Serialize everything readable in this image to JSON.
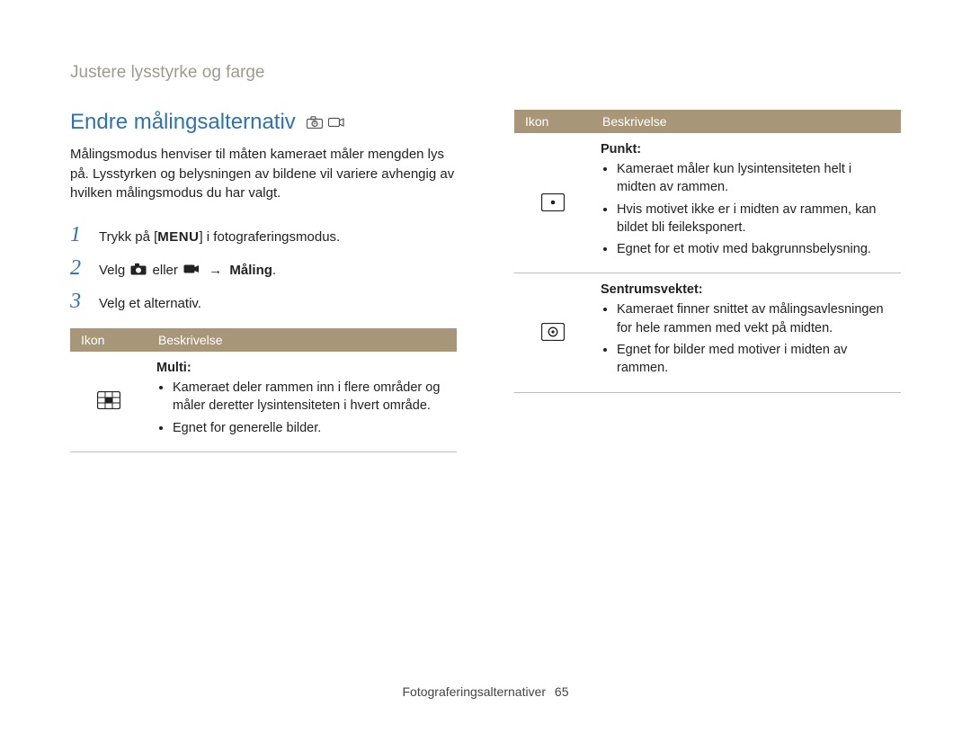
{
  "breadcrumb": "Justere lysstyrke og farge",
  "section_title": "Endre målingsalternativ",
  "intro": "Målingsmodus henviser til måten kameraet måler mengden lys på. Lysstyrken og belysningen av bildene vil variere avhengig av hvilken målingsmodus du har valgt.",
  "steps": {
    "s1": {
      "num": "1",
      "text_a": "Trykk på [",
      "menu": "MENU",
      "text_b": "] i fotograferingsmodus."
    },
    "s2": {
      "num": "2",
      "text_a": "Velg ",
      "text_mid": " eller ",
      "arrow": "→",
      "bold_tail": "Måling",
      "tail": "."
    },
    "s3": {
      "num": "3",
      "text": "Velg et alternativ."
    }
  },
  "table_headers": {
    "icon": "Ikon",
    "desc": "Beskrivelse"
  },
  "rows": {
    "multi": {
      "title": "Multi:",
      "b1": "Kameraet deler rammen inn i flere områder og måler deretter lysintensiteten i hvert område.",
      "b2": "Egnet for generelle bilder."
    },
    "punkt": {
      "title": "Punkt:",
      "b1": "Kameraet måler kun lysintensiteten helt i midten av rammen.",
      "b2": "Hvis motivet ikke er i midten av rammen, kan bildet bli feileksponert.",
      "b3": "Egnet for et motiv med bakgrunnsbelysning."
    },
    "sentrum": {
      "title": "Sentrumsvektet:",
      "b1": "Kameraet finner snittet av målingsavlesningen for hele rammen med vekt på midten.",
      "b2": "Egnet for bilder med motiver i midten av rammen."
    }
  },
  "footer": {
    "label": "Fotograferingsalternativer",
    "page": "65"
  }
}
